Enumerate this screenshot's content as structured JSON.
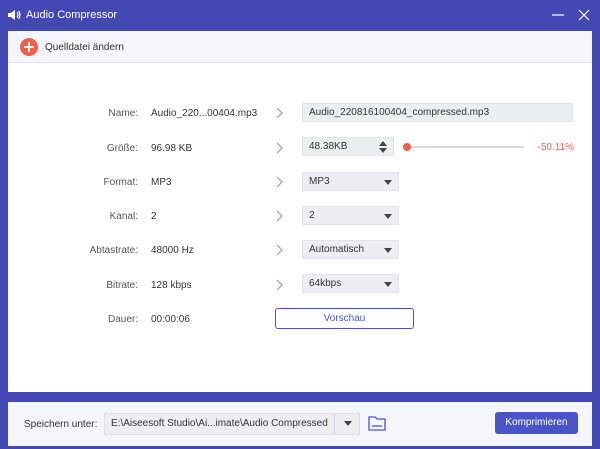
{
  "window": {
    "title": "Audio Compressor"
  },
  "topbar": {
    "change_source_label": "Quelldatei ändern"
  },
  "rows": {
    "name": {
      "label": "Name:",
      "original": "Audio_220...00404.mp3",
      "output": "Audio_220816100404_compressed.mp3"
    },
    "size": {
      "label": "Größe:",
      "original": "96.98 KB",
      "output": "48.38KB",
      "reduction_text": "-50.11%",
      "slider_fraction": 0.0
    },
    "format": {
      "label": "Format:",
      "original": "MP3",
      "selected": "MP3"
    },
    "channel": {
      "label": "Kanal:",
      "original": "2",
      "selected": "2"
    },
    "samplerate": {
      "label": "Abtastrate:",
      "original": "48000 Hz",
      "selected": "Automatisch"
    },
    "bitrate": {
      "label": "Bitrate:",
      "original": "128 kbps",
      "selected": "64kbps"
    },
    "duration": {
      "label": "Dauer:",
      "original": "00:00:06"
    }
  },
  "preview_label": "Vorschau",
  "bottom": {
    "save_label": "Speichern unter:",
    "path": "E:\\Aiseesoft Studio\\Ai...imate\\Audio Compressed",
    "compress_label": "Komprimieren"
  },
  "colors": {
    "accent": "#4a54c8",
    "title_bar": "#4348b5",
    "highlight": "#f0604a"
  },
  "icons": {
    "app": "speaker-icon",
    "minimize": "minimize-icon",
    "close": "close-icon",
    "add": "plus-circle-icon",
    "arrow": "chevron-right-icon",
    "folder": "folder-icon"
  }
}
